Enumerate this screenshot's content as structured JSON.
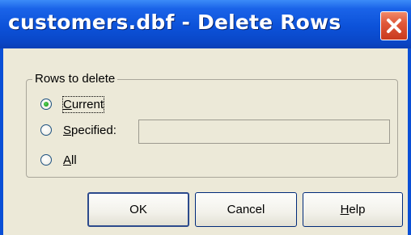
{
  "window": {
    "title": "customers.dbf - Delete Rows"
  },
  "group": {
    "legend": "Rows to delete",
    "options": [
      {
        "key": "current",
        "label_first": "C",
        "label_rest": "urrent",
        "selected": true
      },
      {
        "key": "specified",
        "label_first": "S",
        "label_rest": "pecified:",
        "selected": false
      },
      {
        "key": "all",
        "label_first": "A",
        "label_rest": "ll",
        "selected": false
      }
    ],
    "specified_value": ""
  },
  "buttons": {
    "ok": "OK",
    "cancel": "Cancel",
    "help_first": "H",
    "help_rest": "elp"
  },
  "colors": {
    "titlebar": "#0c52d9",
    "close": "#e0583a",
    "face": "#ece9d8"
  }
}
